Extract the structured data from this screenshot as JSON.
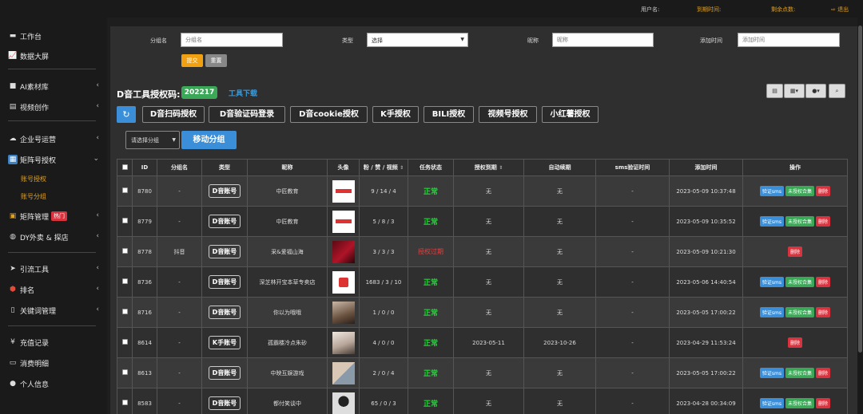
{
  "topbar": {
    "user": "用户名:",
    "expire": "到期时间:",
    "points": "剩余点数:",
    "logout": "退出"
  },
  "sidebar": {
    "items": [
      {
        "label": "工作台",
        "icon": "desktop-icon"
      },
      {
        "label": "数据大屏",
        "icon": "line-chart-icon"
      },
      {
        "label": "AI素材库",
        "icon": "folder-icon"
      },
      {
        "label": "视频创作",
        "icon": "film-icon"
      },
      {
        "label": "企业号运营",
        "icon": "cloud-icon"
      },
      {
        "label": "矩阵号授权",
        "icon": "matrix-icon"
      },
      {
        "label": "矩阵管理",
        "icon": "matrix-manage-icon",
        "badge": "热门"
      },
      {
        "label": "DY外卖 & 探店",
        "icon": "globe-icon"
      },
      {
        "label": "引流工具",
        "icon": "send-icon"
      },
      {
        "label": "排名",
        "icon": "rank-icon"
      },
      {
        "label": "关键词管理",
        "icon": "file-icon"
      },
      {
        "label": "充值记录",
        "icon": "yen-icon"
      },
      {
        "label": "消费明细",
        "icon": "receipt-icon"
      },
      {
        "label": "个人信息",
        "icon": "user-icon"
      }
    ],
    "sub": [
      "账号授权",
      "账号分组"
    ]
  },
  "filters": {
    "group_label": "分组名",
    "group_placeholder": "分组名",
    "type_label": "类型",
    "type_value": "选择",
    "nick_label": "昵称",
    "nick_placeholder": "昵称",
    "time_label": "添加时间",
    "time_placeholder": "添加时间",
    "submit": "提交",
    "reset": "重置"
  },
  "auth": {
    "label": "D音工具授权码:",
    "code": "202217",
    "download": "工具下载"
  },
  "auth_buttons": [
    "D音扫码授权",
    "D音验证码登录",
    "D音cookie授权",
    "K手授权",
    "BILI授权",
    "视频号授权",
    "小红薯授权"
  ],
  "group_select": "请选择分组",
  "move_group": "移动分组",
  "table": {
    "headers": [
      "ID",
      "分组名",
      "类型",
      "昵称",
      "头像",
      "粉 / 赞 / 视频",
      "任务状态",
      "授权到期",
      "自动续期",
      "sms验证时间",
      "添加时间",
      "操作"
    ],
    "rows": [
      {
        "id": "8780",
        "group": "-",
        "type": "D音账号",
        "nick": "中匠教育",
        "avatar": "logo",
        "stats": "9 / 14 / 4",
        "status": "正常",
        "status_ok": true,
        "expire": "无",
        "renew": "无",
        "sms": "-",
        "added": "2023-05-09 10:37:48",
        "ops": [
          "验证sms",
          "未授权合集",
          "删除"
        ]
      },
      {
        "id": "8779",
        "group": "-",
        "type": "D音账号",
        "nick": "中匠教育",
        "avatar": "logo",
        "stats": "5 / 8 / 3",
        "status": "正常",
        "status_ok": true,
        "expire": "无",
        "renew": "无",
        "sms": "-",
        "added": "2023-05-09 10:35:52",
        "ops": [
          "验证sms",
          "未授权合集",
          "删除"
        ]
      },
      {
        "id": "8778",
        "group": "抖音",
        "type": "D音账号",
        "nick": "采&爱福山海",
        "avatar": "dark",
        "stats": "3 / 3 / 3",
        "status": "授权过期",
        "status_ok": false,
        "expire": "无",
        "renew": "无",
        "sms": "-",
        "added": "2023-05-09 10:21:30",
        "ops": [
          "删除"
        ]
      },
      {
        "id": "8736",
        "group": "-",
        "type": "D音账号",
        "nick": "深芝林开宝本草专卖店",
        "avatar": "shop",
        "stats": "1683 / 3 / 10",
        "status": "正常",
        "status_ok": true,
        "expire": "无",
        "renew": "无",
        "sms": "-",
        "added": "2023-05-06 14:40:54",
        "ops": [
          "验证sms",
          "未授权合集",
          "删除"
        ]
      },
      {
        "id": "8716",
        "group": "-",
        "type": "D音账号",
        "nick": "你以为哦哦",
        "avatar": "people",
        "stats": "1 / 0 / 0",
        "status": "正常",
        "status_ok": true,
        "expire": "无",
        "renew": "无",
        "sms": "-",
        "added": "2023-05-05 17:00:22",
        "ops": [
          "验证sms",
          "未授权合集",
          "删除"
        ]
      },
      {
        "id": "8614",
        "group": "-",
        "type": "K手账号",
        "nick": "孤霸楼冷点朱砂",
        "avatar": "photo",
        "stats": "4 / 0 / 0",
        "status": "正常",
        "status_ok": true,
        "expire": "2023-05-11",
        "renew": "2023-10-26",
        "sms": "-",
        "added": "2023-04-29 11:53:24",
        "ops": [
          "删除"
        ]
      },
      {
        "id": "8613",
        "group": "-",
        "type": "D音账号",
        "nick": "中映互娱游戏",
        "avatar": "grid",
        "stats": "2 / 0 / 4",
        "status": "正常",
        "status_ok": true,
        "expire": "无",
        "renew": "无",
        "sms": "-",
        "added": "2023-05-05 17:00:22",
        "ops": [
          "验证sms",
          "未授权合集",
          "删除"
        ]
      },
      {
        "id": "8583",
        "group": "-",
        "type": "D音账号",
        "nick": "都付笑谈中",
        "avatar": "bw",
        "stats": "65 / 0 / 3",
        "status": "正常",
        "status_ok": true,
        "expire": "无",
        "renew": "无",
        "sms": "-",
        "added": "2023-04-28 00:34:09",
        "ops": [
          "验证sms",
          "未授权合集",
          "删除"
        ]
      }
    ]
  },
  "colors": {
    "accent": "#f0a010",
    "primary": "#3b8fd9",
    "ok": "#21d336",
    "danger": "#d9333f",
    "success": "#3aa856"
  }
}
